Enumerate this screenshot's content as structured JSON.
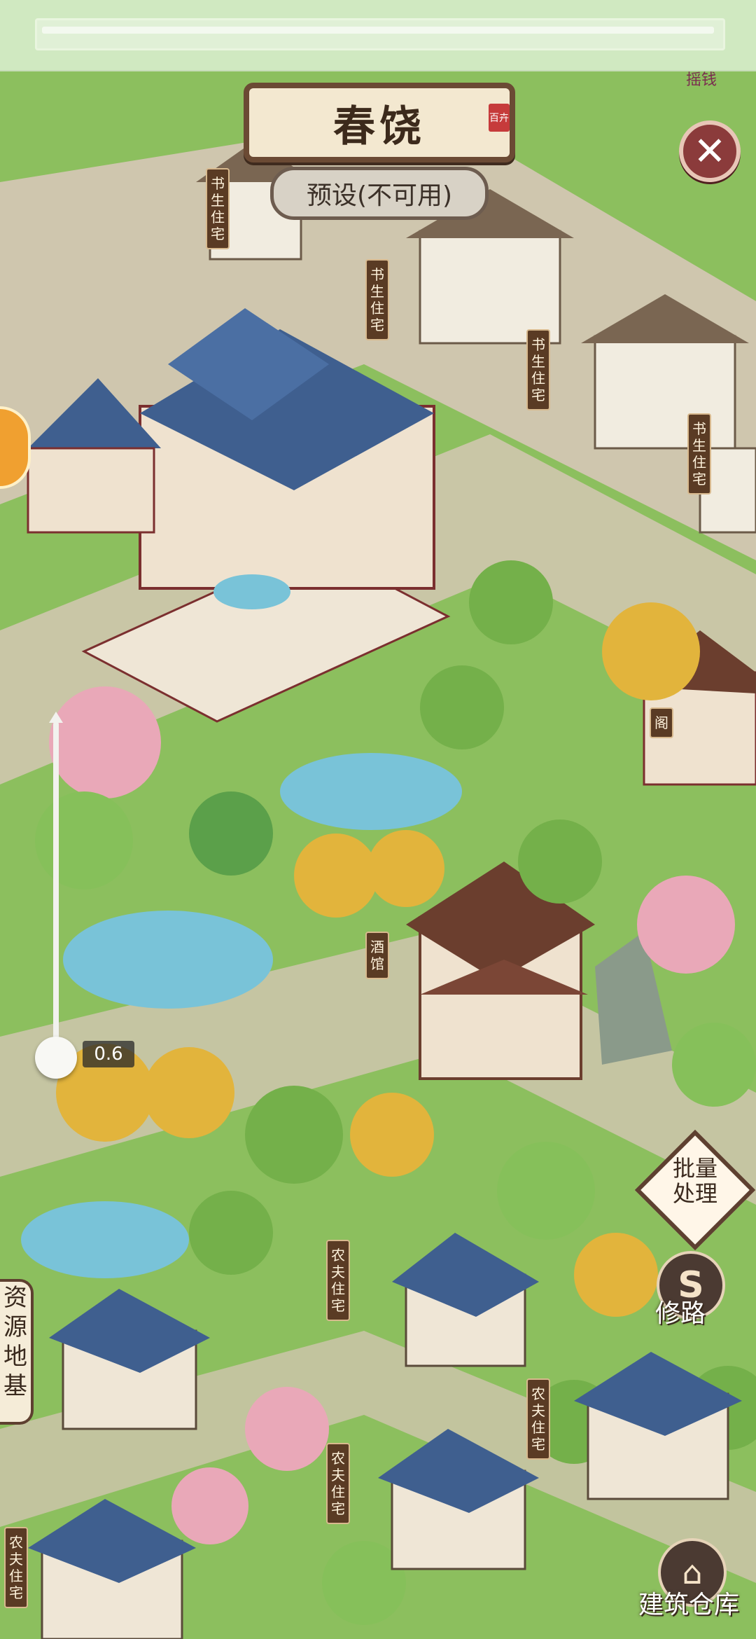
{
  "season": {
    "title": "春饶",
    "seal": "百卉"
  },
  "preset_button": {
    "label": "预设(不可用)"
  },
  "top_right": {
    "money_text": "摇钱"
  },
  "zoom": {
    "value_text": "0.6",
    "level": 0.6
  },
  "buildings": {
    "scholar_1": "书生住宅",
    "scholar_2": "书生住宅",
    "scholar_3": "书生住宅",
    "scholar_4": "书生住宅",
    "pavilion": "阁",
    "tavern": "酒馆",
    "farmer_1": "农夫住宅",
    "farmer_2": "农夫住宅",
    "farmer_3": "农夫住宅",
    "farmer_4": "农夫住宅"
  },
  "side_buttons": {
    "batch": "批量处理",
    "road": "修路",
    "warehouse": "建筑仓库",
    "resource_tab": "资源地基"
  },
  "colors": {
    "grass": "#8cbf5e",
    "path": "#cfc6ae",
    "roof_blue": "#3f5f8f",
    "roof_brown": "#6b3e2e",
    "wood": "#5a3b24"
  }
}
